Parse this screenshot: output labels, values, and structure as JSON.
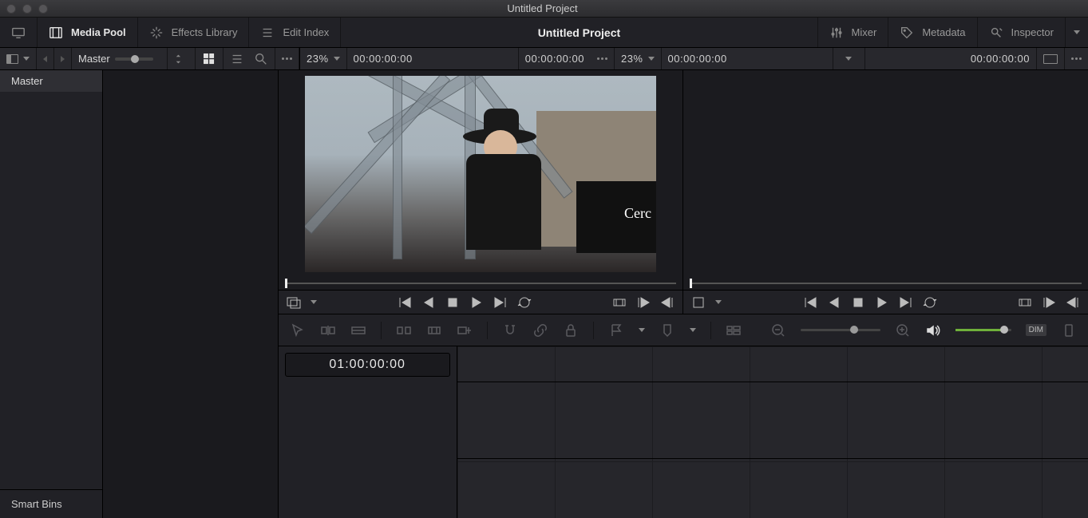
{
  "window": {
    "title": "Untitled Project"
  },
  "topbar": {
    "mediaPool": "Media Pool",
    "effects": "Effects Library",
    "editIndex": "Edit Index",
    "center": "Untitled Project",
    "mixer": "Mixer",
    "metadata": "Metadata",
    "inspector": "Inspector"
  },
  "subbar": {
    "bin": "Master",
    "zoomA": "23%",
    "tcA1": "00:00:00:00",
    "tcA2": "00:00:00:00",
    "zoomB": "23%",
    "tcB1": "00:00:00:00",
    "tcB2": "00:00:00:00"
  },
  "sidebar": {
    "items": [
      "Master"
    ],
    "smartBins": "Smart Bins"
  },
  "source": {
    "bannerText": "Cerc"
  },
  "timeline": {
    "tc": "01:00:00:00"
  },
  "toolbar": {
    "dim": "DIM"
  }
}
